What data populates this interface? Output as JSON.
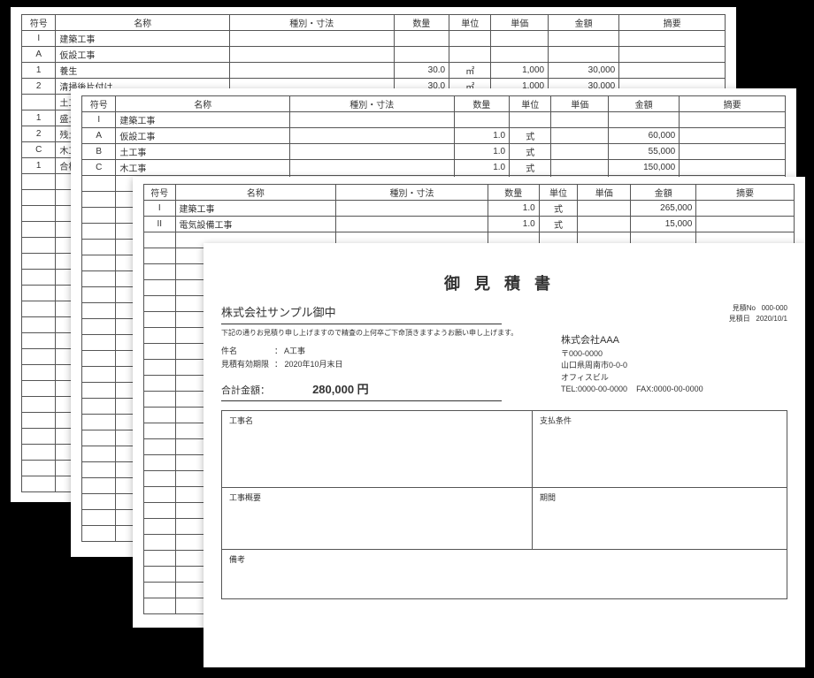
{
  "headers": {
    "code": "符号",
    "name": "名称",
    "spec": "種別・寸法",
    "qty": "数量",
    "unit": "単位",
    "price": "単価",
    "amount": "金額",
    "note": "摘要"
  },
  "layer1": {
    "rows": [
      {
        "code": "I",
        "name": "建築工事",
        "spec": "",
        "qty": "",
        "unit": "",
        "price": "",
        "amount": "",
        "note": ""
      },
      {
        "code": "A",
        "name": "仮設工事",
        "spec": "",
        "qty": "",
        "unit": "",
        "price": "",
        "amount": "",
        "note": ""
      },
      {
        "code": "1",
        "name": "養生",
        "spec": "",
        "qty": "30.0",
        "unit": "㎡",
        "price": "1,000",
        "amount": "30,000",
        "note": ""
      },
      {
        "code": "2",
        "name": "清掃後片付け",
        "spec": "",
        "qty": "30.0",
        "unit": "㎡",
        "price": "1,000",
        "amount": "30,000",
        "note": ""
      },
      {
        "code": "",
        "name": "土工",
        "spec": "",
        "qty": "",
        "unit": "",
        "price": "",
        "amount": "",
        "note": ""
      },
      {
        "code": "1",
        "name": "盛土",
        "spec": "",
        "qty": "",
        "unit": "",
        "price": "",
        "amount": "",
        "note": ""
      },
      {
        "code": "2",
        "name": "残土",
        "spec": "",
        "qty": "",
        "unit": "",
        "price": "",
        "amount": "",
        "note": ""
      },
      {
        "code": "C",
        "name": "木工",
        "spec": "",
        "qty": "",
        "unit": "",
        "price": "",
        "amount": "",
        "note": ""
      },
      {
        "code": "1",
        "name": "合板",
        "spec": "",
        "qty": "",
        "unit": "",
        "price": "",
        "amount": "",
        "note": ""
      }
    ]
  },
  "layer2": {
    "rows": [
      {
        "code": "I",
        "name": "建築工事",
        "spec": "",
        "qty": "",
        "unit": "",
        "price": "",
        "amount": "",
        "note": ""
      },
      {
        "code": "A",
        "name": "仮設工事",
        "spec": "",
        "qty": "1.0",
        "unit": "式",
        "price": "",
        "amount": "60,000",
        "note": ""
      },
      {
        "code": "B",
        "name": "土工事",
        "spec": "",
        "qty": "1.0",
        "unit": "式",
        "price": "",
        "amount": "55,000",
        "note": ""
      },
      {
        "code": "C",
        "name": "木工事",
        "spec": "",
        "qty": "1.0",
        "unit": "式",
        "price": "",
        "amount": "150,000",
        "note": ""
      }
    ]
  },
  "layer3": {
    "rows": [
      {
        "code": "I",
        "name": "建築工事",
        "spec": "",
        "qty": "1.0",
        "unit": "式",
        "price": "",
        "amount": "265,000",
        "note": ""
      },
      {
        "code": "II",
        "name": "電気設備工事",
        "spec": "",
        "qty": "1.0",
        "unit": "式",
        "price": "",
        "amount": "15,000",
        "note": ""
      }
    ]
  },
  "cover": {
    "title": "御見積書",
    "meta": {
      "doc_no_label": "見積No",
      "doc_no": "000-000",
      "date_label": "見積日",
      "date": "2020/10/1"
    },
    "client": "株式会社サンプル御中",
    "intro": "下記の通りお見積り申し上げますので精査の上何卒ご下命頂きますようお願い申し上げます。",
    "subject_label": "件名",
    "subject": "A工事",
    "valid_label": "見積有効期限",
    "valid": "2020年10月末日",
    "total_label": "合計金額：",
    "total_value": "280,000 円",
    "company": {
      "name": "株式会社AAA",
      "zip": "〒000-0000",
      "addr": "山口県周南市0-0-0",
      "bldg": "オフィスビル",
      "tel": "TEL:0000-00-0000",
      "fax": "FAX:0000-00-0000"
    },
    "box_labels": {
      "work_name": "工事名",
      "pay_terms": "支払条件",
      "work_outline": "工事概要",
      "period": "期間",
      "remarks": "備考"
    }
  }
}
